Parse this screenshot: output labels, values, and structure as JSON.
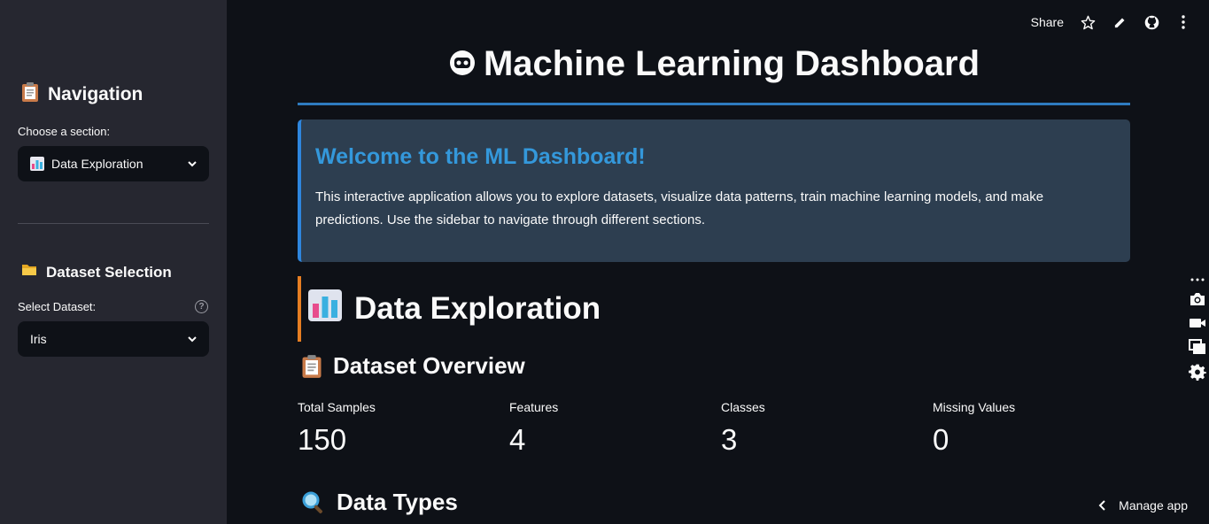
{
  "toolbar": {
    "share_label": "Share"
  },
  "sidebar": {
    "nav_title": "Navigation",
    "nav_emoji": "clipboard-icon",
    "section_label": "Choose a section:",
    "section_value": "Data Exploration",
    "dataset_title": "Dataset Selection",
    "dataset_label": "Select Dataset:",
    "dataset_value": "Iris",
    "help": "?"
  },
  "main": {
    "title": "Machine Learning Dashboard",
    "welcome_title": "Welcome to the ML Dashboard!",
    "welcome_text": "This interactive application allows you to explore datasets, visualize data patterns, train machine learning models, and make predictions. Use the sidebar to navigate through different sections.",
    "section_title": "Data Exploration",
    "overview_title": "Dataset Overview",
    "datatypes_title": "Data Types",
    "metrics": [
      {
        "label": "Total Samples",
        "value": "150"
      },
      {
        "label": "Features",
        "value": "4"
      },
      {
        "label": "Classes",
        "value": "3"
      },
      {
        "label": "Missing Values",
        "value": "0"
      }
    ]
  },
  "footer": {
    "manage_label": "Manage app"
  },
  "colors": {
    "accent_blue": "#3498db",
    "accent_orange": "#e67e22",
    "sidebar_bg": "#262730",
    "page_bg": "#0e1117"
  }
}
